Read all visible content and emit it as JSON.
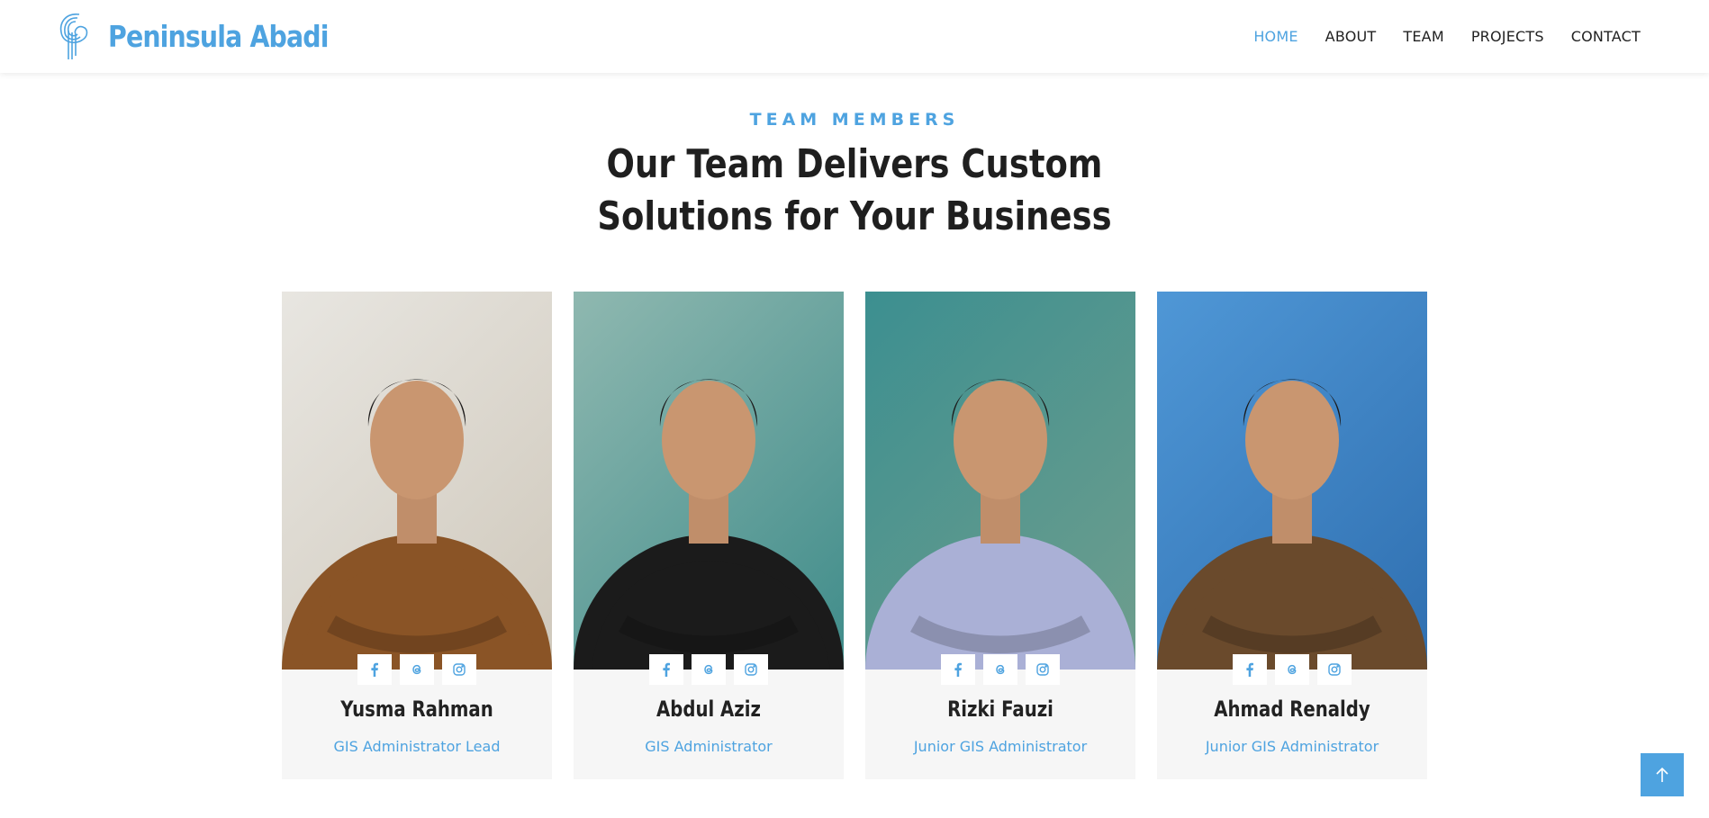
{
  "brand": {
    "name": "Peninsula Abadi",
    "color": "#4ea3e0"
  },
  "nav": [
    {
      "label": "HOME",
      "active": true
    },
    {
      "label": "ABOUT",
      "active": false
    },
    {
      "label": "TEAM",
      "active": false
    },
    {
      "label": "PROJECTS",
      "active": false
    },
    {
      "label": "CONTACT",
      "active": false
    }
  ],
  "section": {
    "eyebrow": "TEAM MEMBERS",
    "title_line1": "Our Team Delivers Custom",
    "title_line2": "Solutions for Your Business"
  },
  "members": [
    {
      "name": "Yusma Rahman",
      "role": "GIS Administrator Lead",
      "shirt": "#8a5426",
      "bg": [
        "#e8e6e1",
        "#cfc8bb"
      ],
      "socials": [
        "facebook-icon",
        "threads-icon",
        "instagram-icon"
      ]
    },
    {
      "name": "Abdul Aziz",
      "role": "GIS Administrator",
      "shirt": "#1b1b1b",
      "bg": [
        "#8fb8b0",
        "#3f8c8a"
      ],
      "socials": [
        "facebook-icon",
        "threads-icon",
        "instagram-icon"
      ]
    },
    {
      "name": "Rizki Fauzi",
      "role": "Junior GIS Administrator",
      "shirt": "#aab0d6",
      "bg": [
        "#3c8f90",
        "#6f9e8d"
      ],
      "socials": [
        "facebook-icon",
        "threads-icon",
        "instagram-icon"
      ]
    },
    {
      "name": "Ahmad Renaldy",
      "role": "Junior GIS Administrator",
      "shirt": "#6a4a2c",
      "bg": [
        "#4f97d6",
        "#2f6fb0"
      ],
      "socials": [
        "facebook-icon",
        "threads-icon",
        "instagram-icon"
      ]
    }
  ],
  "back_to_top": {
    "icon": "arrow-up-icon"
  }
}
